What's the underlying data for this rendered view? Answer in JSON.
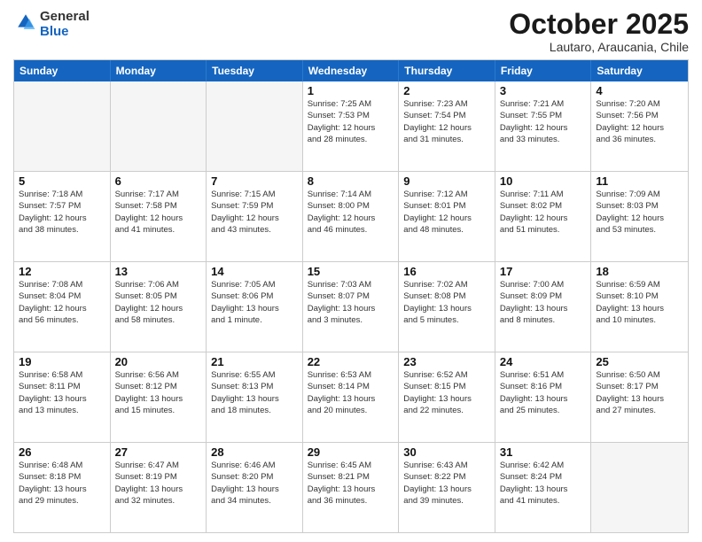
{
  "header": {
    "logo_general": "General",
    "logo_blue": "Blue",
    "month_title": "October 2025",
    "location": "Lautaro, Araucania, Chile"
  },
  "days_of_week": [
    "Sunday",
    "Monday",
    "Tuesday",
    "Wednesday",
    "Thursday",
    "Friday",
    "Saturday"
  ],
  "weeks": [
    [
      {
        "day": "",
        "info": ""
      },
      {
        "day": "",
        "info": ""
      },
      {
        "day": "",
        "info": ""
      },
      {
        "day": "1",
        "info": "Sunrise: 7:25 AM\nSunset: 7:53 PM\nDaylight: 12 hours\nand 28 minutes."
      },
      {
        "day": "2",
        "info": "Sunrise: 7:23 AM\nSunset: 7:54 PM\nDaylight: 12 hours\nand 31 minutes."
      },
      {
        "day": "3",
        "info": "Sunrise: 7:21 AM\nSunset: 7:55 PM\nDaylight: 12 hours\nand 33 minutes."
      },
      {
        "day": "4",
        "info": "Sunrise: 7:20 AM\nSunset: 7:56 PM\nDaylight: 12 hours\nand 36 minutes."
      }
    ],
    [
      {
        "day": "5",
        "info": "Sunrise: 7:18 AM\nSunset: 7:57 PM\nDaylight: 12 hours\nand 38 minutes."
      },
      {
        "day": "6",
        "info": "Sunrise: 7:17 AM\nSunset: 7:58 PM\nDaylight: 12 hours\nand 41 minutes."
      },
      {
        "day": "7",
        "info": "Sunrise: 7:15 AM\nSunset: 7:59 PM\nDaylight: 12 hours\nand 43 minutes."
      },
      {
        "day": "8",
        "info": "Sunrise: 7:14 AM\nSunset: 8:00 PM\nDaylight: 12 hours\nand 46 minutes."
      },
      {
        "day": "9",
        "info": "Sunrise: 7:12 AM\nSunset: 8:01 PM\nDaylight: 12 hours\nand 48 minutes."
      },
      {
        "day": "10",
        "info": "Sunrise: 7:11 AM\nSunset: 8:02 PM\nDaylight: 12 hours\nand 51 minutes."
      },
      {
        "day": "11",
        "info": "Sunrise: 7:09 AM\nSunset: 8:03 PM\nDaylight: 12 hours\nand 53 minutes."
      }
    ],
    [
      {
        "day": "12",
        "info": "Sunrise: 7:08 AM\nSunset: 8:04 PM\nDaylight: 12 hours\nand 56 minutes."
      },
      {
        "day": "13",
        "info": "Sunrise: 7:06 AM\nSunset: 8:05 PM\nDaylight: 12 hours\nand 58 minutes."
      },
      {
        "day": "14",
        "info": "Sunrise: 7:05 AM\nSunset: 8:06 PM\nDaylight: 13 hours\nand 1 minute."
      },
      {
        "day": "15",
        "info": "Sunrise: 7:03 AM\nSunset: 8:07 PM\nDaylight: 13 hours\nand 3 minutes."
      },
      {
        "day": "16",
        "info": "Sunrise: 7:02 AM\nSunset: 8:08 PM\nDaylight: 13 hours\nand 5 minutes."
      },
      {
        "day": "17",
        "info": "Sunrise: 7:00 AM\nSunset: 8:09 PM\nDaylight: 13 hours\nand 8 minutes."
      },
      {
        "day": "18",
        "info": "Sunrise: 6:59 AM\nSunset: 8:10 PM\nDaylight: 13 hours\nand 10 minutes."
      }
    ],
    [
      {
        "day": "19",
        "info": "Sunrise: 6:58 AM\nSunset: 8:11 PM\nDaylight: 13 hours\nand 13 minutes."
      },
      {
        "day": "20",
        "info": "Sunrise: 6:56 AM\nSunset: 8:12 PM\nDaylight: 13 hours\nand 15 minutes."
      },
      {
        "day": "21",
        "info": "Sunrise: 6:55 AM\nSunset: 8:13 PM\nDaylight: 13 hours\nand 18 minutes."
      },
      {
        "day": "22",
        "info": "Sunrise: 6:53 AM\nSunset: 8:14 PM\nDaylight: 13 hours\nand 20 minutes."
      },
      {
        "day": "23",
        "info": "Sunrise: 6:52 AM\nSunset: 8:15 PM\nDaylight: 13 hours\nand 22 minutes."
      },
      {
        "day": "24",
        "info": "Sunrise: 6:51 AM\nSunset: 8:16 PM\nDaylight: 13 hours\nand 25 minutes."
      },
      {
        "day": "25",
        "info": "Sunrise: 6:50 AM\nSunset: 8:17 PM\nDaylight: 13 hours\nand 27 minutes."
      }
    ],
    [
      {
        "day": "26",
        "info": "Sunrise: 6:48 AM\nSunset: 8:18 PM\nDaylight: 13 hours\nand 29 minutes."
      },
      {
        "day": "27",
        "info": "Sunrise: 6:47 AM\nSunset: 8:19 PM\nDaylight: 13 hours\nand 32 minutes."
      },
      {
        "day": "28",
        "info": "Sunrise: 6:46 AM\nSunset: 8:20 PM\nDaylight: 13 hours\nand 34 minutes."
      },
      {
        "day": "29",
        "info": "Sunrise: 6:45 AM\nSunset: 8:21 PM\nDaylight: 13 hours\nand 36 minutes."
      },
      {
        "day": "30",
        "info": "Sunrise: 6:43 AM\nSunset: 8:22 PM\nDaylight: 13 hours\nand 39 minutes."
      },
      {
        "day": "31",
        "info": "Sunrise: 6:42 AM\nSunset: 8:24 PM\nDaylight: 13 hours\nand 41 minutes."
      },
      {
        "day": "",
        "info": ""
      }
    ]
  ]
}
